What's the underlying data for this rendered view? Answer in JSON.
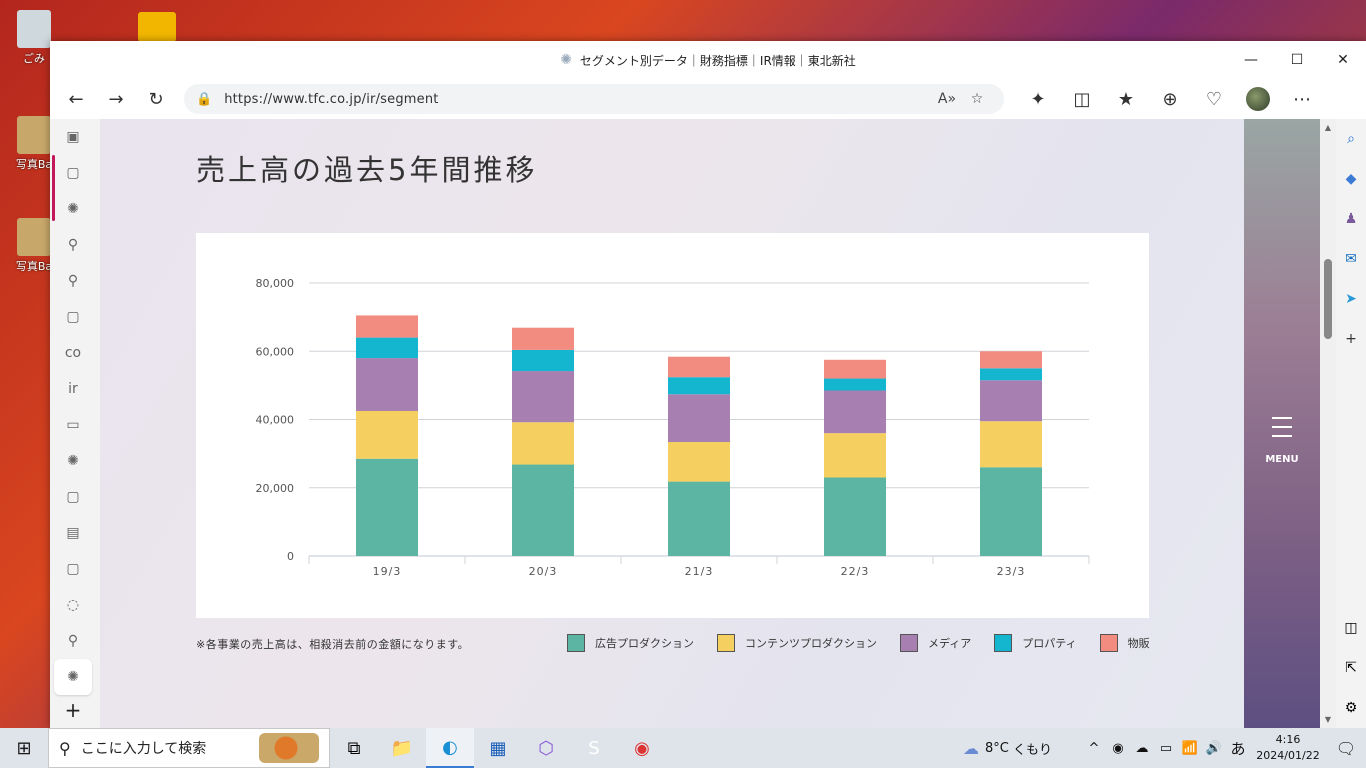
{
  "desktop": {
    "icons": [
      {
        "label": "ごみ",
        "color": "#cfd8dc"
      },
      {
        "label": "写真Ba",
        "color": "#c8a86a"
      },
      {
        "label": "写真Ba",
        "color": "#c8a86a"
      }
    ]
  },
  "window": {
    "title": "セグメント別データ｜財務指標｜IR情報｜東北新社",
    "min": "—",
    "max": "☐",
    "close": "✕"
  },
  "toolbar": {
    "back": "←",
    "forward": "→",
    "reload": "↻",
    "url": "https://www.tfc.co.jp/ir/segment",
    "read_aloud": "A»",
    "favorite": "☆",
    "extensions": "✦",
    "split": "◫",
    "favorites": "★",
    "collections": "⊕",
    "health": "♡",
    "more": "⋯"
  },
  "vtabs": {
    "items": [
      "▣",
      "▢",
      "✺",
      "⚲",
      "⚲",
      "▢",
      "co",
      "ir",
      "▭",
      "✺",
      "▢",
      "▤",
      "▢",
      "◌",
      "⚲",
      "✺",
      "+"
    ]
  },
  "page": {
    "title": "売上高の過去5年間推移",
    "note": "※各事業の売上高は、相殺消去前の金額になります。",
    "menu_label": "MENU"
  },
  "chart_data": {
    "type": "bar",
    "stacked": true,
    "categories": [
      "19/3",
      "20/3",
      "21/3",
      "22/3",
      "23/3"
    ],
    "ylim": [
      0,
      80000
    ],
    "yticks": [
      "0",
      "20,000",
      "40,000",
      "60,000",
      "80,000"
    ],
    "grid": true,
    "legend_position": "bottom-right",
    "series": [
      {
        "name": "広告プロダクション",
        "color": "#5bb5a2",
        "values": [
          28500,
          26800,
          21800,
          23000,
          26000
        ]
      },
      {
        "name": "コンテンツプロダクション",
        "color": "#f5cf5f",
        "values": [
          14000,
          12400,
          11600,
          13000,
          13500
        ]
      },
      {
        "name": "メディア",
        "color": "#a77fb0",
        "values": [
          15500,
          15000,
          14000,
          12500,
          12000
        ]
      },
      {
        "name": "プロパティ",
        "color": "#14b5cf",
        "values": [
          6000,
          6200,
          5000,
          3500,
          3500
        ]
      },
      {
        "name": "物販",
        "color": "#f28b80",
        "values": [
          6500,
          6500,
          6000,
          5500,
          5000
        ]
      }
    ]
  },
  "edgebar": {
    "items": [
      "⌕",
      "◆",
      "♟",
      "✉",
      "➤",
      "+"
    ],
    "bottom": [
      "◫",
      "⇱",
      "⚙"
    ]
  },
  "taskbar": {
    "start": "⊞",
    "search_placeholder": "ここに入力して検索",
    "apps": [
      "⧉",
      "📁",
      "◐",
      "▦",
      "⬡",
      "S",
      "◉"
    ],
    "weather_temp": "8°C",
    "weather_text": "くもり",
    "ime": "あ",
    "time": "4:16",
    "date": "2024/01/22",
    "tray_icons": [
      "^",
      "◉",
      "☁",
      "▭",
      "📶",
      "🔊"
    ]
  }
}
